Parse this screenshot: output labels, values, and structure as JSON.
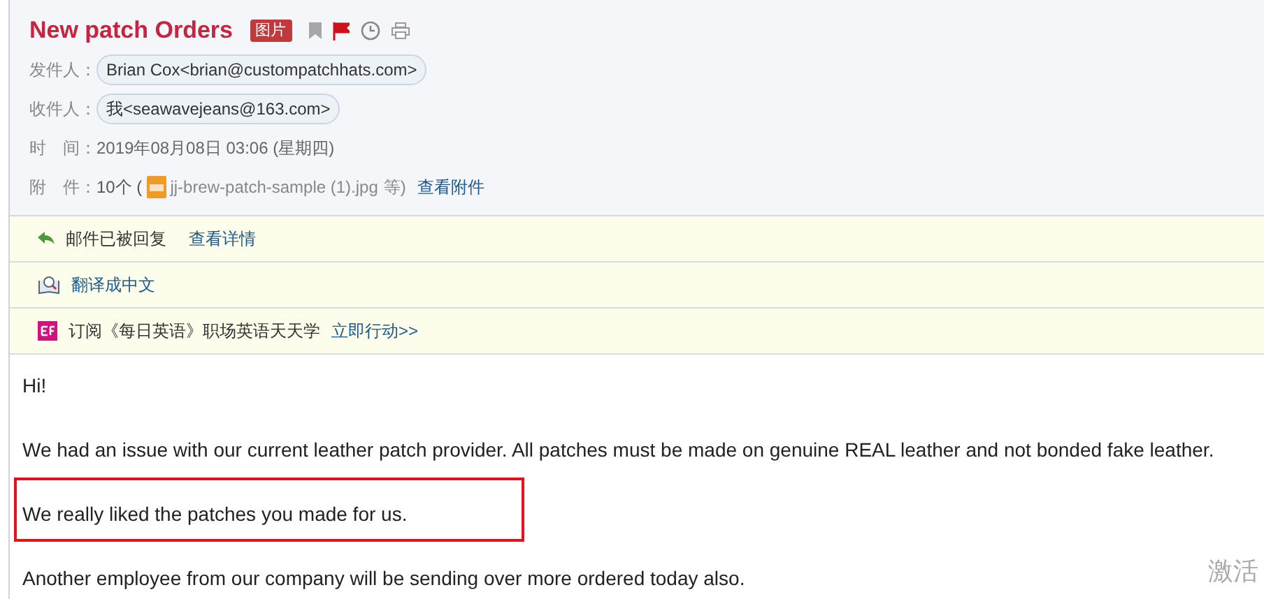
{
  "subject": {
    "title": "New patch Orders",
    "tag": "图片"
  },
  "fields": [
    {
      "kind": "contact",
      "label": "发件人：",
      "value": "Brian Cox<brian@custompatchhats.com>"
    },
    {
      "kind": "contact",
      "label": "收件人：",
      "value": "我<seawavejeans@163.com>"
    },
    {
      "kind": "text",
      "label": "时　间：",
      "value": "2019年08月08日 03:06 (星期四)"
    },
    {
      "kind": "attachment",
      "label": "附　件：",
      "count": "10个 (",
      "file": "jj-brew-patch-sample (1).jpg",
      "suffix": "等)",
      "link": "查看附件"
    }
  ],
  "notices": [
    {
      "kind": "reply",
      "text": "邮件已被回复",
      "link": "查看详情"
    },
    {
      "kind": "translate",
      "link": "翻译成中文"
    },
    {
      "kind": "ad",
      "text": "订阅《每日英语》职场英语天天学",
      "link": "立即行动>>"
    }
  ],
  "body": [
    "Hi!",
    "We had an issue with our current leather patch provider. All patches must be made on genuine REAL leather and not bonded fake leather.",
    "We really liked the patches you made for us.",
    "Another employee from our company will be sending over more ordered today also."
  ],
  "highlight_box": {
    "color": "#e8101c"
  },
  "activation_notice": "激活"
}
